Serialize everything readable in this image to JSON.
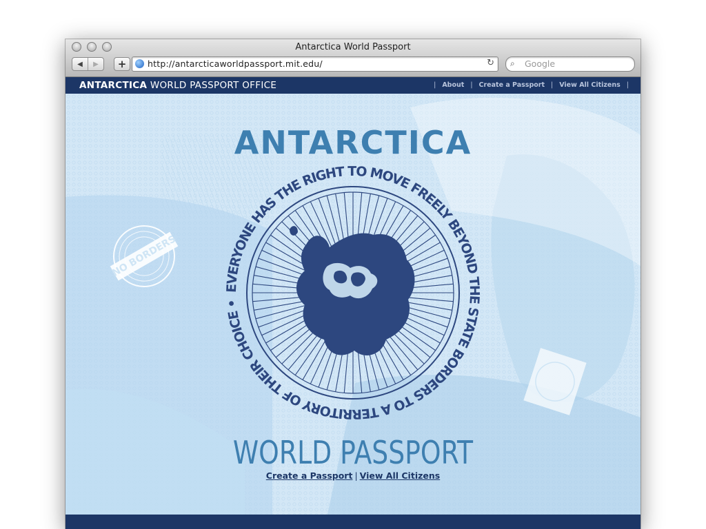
{
  "browser": {
    "title": "Antarctica World Passport",
    "url": "http://antarcticaworldpassport.mit.edu/",
    "search_placeholder": "Google"
  },
  "site": {
    "brand_bold": "ANTARCTICA",
    "brand_rest": " WORLD PASSPORT OFFICE",
    "nav": [
      {
        "label": "About"
      },
      {
        "label": "Create a Passport"
      },
      {
        "label": "View All Citizens"
      }
    ]
  },
  "hero": {
    "title": "ANTARCTICA",
    "seal_text": "EVERYONE HAS THE RIGHT TO MOVE FREELY BEYOND THE STATE BORDERS TO A TERRITORY OF THEIR CHOICE •",
    "stamp_text": "NO BORDERS",
    "subtitle": "WORLD PASSPORT",
    "links": [
      {
        "label": "Create a Passport"
      },
      {
        "label": "View All Citizens"
      }
    ],
    "separator": "|"
  },
  "colors": {
    "navy": "#1c3666",
    "accent": "#3e7fb0",
    "seal": "#2d477f",
    "hero_bg": "#cfe5f5"
  }
}
